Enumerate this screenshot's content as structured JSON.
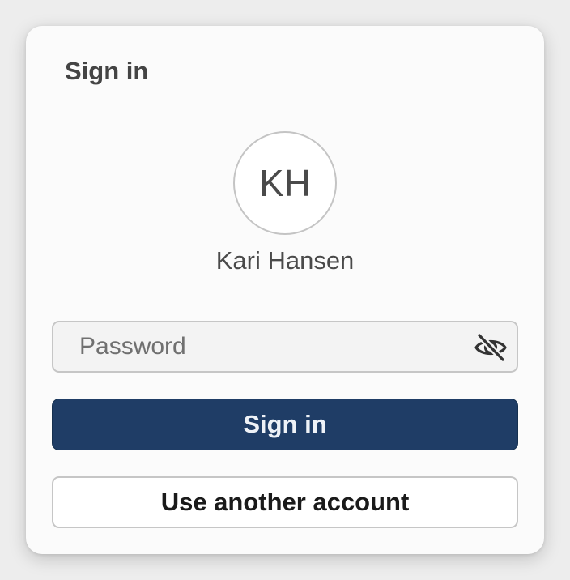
{
  "header": {
    "title": "Sign in"
  },
  "account": {
    "initials": "KH",
    "name": "Kari Hansen"
  },
  "password": {
    "value": "",
    "placeholder": "Password",
    "toggle_icon": "eye-slash-icon"
  },
  "actions": {
    "primary_label": "Sign in",
    "secondary_label": "Use another account"
  },
  "colors": {
    "primary_button": "#1f3d66",
    "primary_text": "#eef2f7",
    "card_background": "#fbfbfb",
    "page_background": "#ededed"
  }
}
